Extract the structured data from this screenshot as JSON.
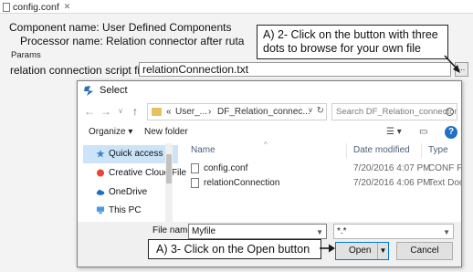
{
  "editor_tab": {
    "title": "config.conf",
    "close_glyph": "✕"
  },
  "config": {
    "component_line": "Component name: User Defined Components",
    "processor_line": "Processor name: Relation connector after ruta",
    "params_label": "Params",
    "script_label": "relation connection script file",
    "script_value": "relationConnection.txt",
    "browse_label": "..."
  },
  "callouts": {
    "a2_line1": "A) 2- Click on the button with three",
    "a2_line2": "dots to browse for your own file",
    "a3": "A) 3- Click on the Open button",
    "color": "#1a1a1a"
  },
  "dialog": {
    "title": "Select",
    "nav": {
      "back": "←",
      "forward": "→",
      "recent": "∨",
      "up": "↑"
    },
    "address": {
      "chevron": "«",
      "seg1": "User_...",
      "sep": "›",
      "seg2": "DF_Relation_connec...",
      "drop": "∨",
      "refresh": "↻"
    },
    "search_placeholder": "Search DF_Relation_connector...",
    "toolbar": {
      "organize": "Organize ▾",
      "new_folder": "New folder",
      "view_glyph": "☰ ▾",
      "pane_glyph": "▭",
      "help": "?"
    },
    "nav_pane": [
      {
        "label": "Quick access",
        "icon": "star-icon",
        "selected": true
      },
      {
        "label": "Creative Cloud File",
        "icon": "creative-cloud-icon",
        "selected": false
      },
      {
        "label": "OneDrive",
        "icon": "cloud-icon",
        "selected": false
      },
      {
        "label": "This PC",
        "icon": "computer-icon",
        "selected": false
      }
    ],
    "columns": {
      "name": "Name",
      "date": "Date modified",
      "type": "Type",
      "sort_glyph": "^"
    },
    "files": [
      {
        "name": "config.conf",
        "date": "7/20/2016 4:07 PM",
        "type": "CONF File"
      },
      {
        "name": "relationConnection",
        "date": "7/20/2016 4:06 PM",
        "type": "Text Docu"
      }
    ],
    "file_name_label": "File name:",
    "file_name_value": "Myfile",
    "file_type_value": "*.*",
    "open_label": "Open",
    "cancel_label": "Cancel",
    "colors": {
      "accent": "#0078d7",
      "selected": "#cce4f7",
      "folder": "#e8c15a"
    }
  }
}
